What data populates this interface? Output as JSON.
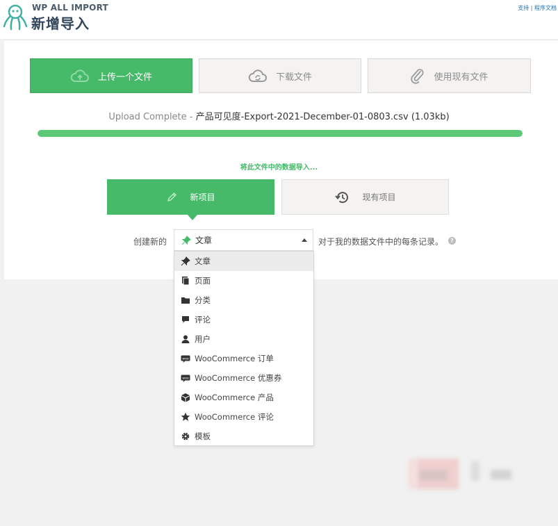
{
  "header": {
    "brand": "WP ALL IMPORT",
    "title": "新增导入",
    "links": [
      "支持",
      "程序文档"
    ],
    "separator": "|"
  },
  "tabs": [
    {
      "label": "上传一个文件",
      "icon": "cloud-upload-icon",
      "active": true
    },
    {
      "label": "下载文件",
      "icon": "cloud-download-icon",
      "active": false
    },
    {
      "label": "使用现有文件",
      "icon": "paperclip-icon",
      "active": false
    }
  ],
  "upload": {
    "status_prefix": "Upload Complete",
    "separator": " - ",
    "filename": "产品可见度-Export-2021-December-01-0803.csv",
    "size": "(1.03kb)",
    "progress": 1.0
  },
  "import_hint": "将此文件中的数据导入...",
  "choices": [
    {
      "label": "新项目",
      "icon": "pencil-icon",
      "active": true
    },
    {
      "label": "现有项目",
      "icon": "history-icon",
      "active": false
    }
  ],
  "create": {
    "prefix": "创建新的",
    "selected": "文章",
    "suffix": "对于我的数据文件中的每条记录。",
    "help": "?"
  },
  "dropdown": {
    "options": [
      {
        "label": "文章",
        "icon": "pushpin-icon"
      },
      {
        "label": "页面",
        "icon": "pages-icon"
      },
      {
        "label": "分类",
        "icon": "folder-icon"
      },
      {
        "label": "评论",
        "icon": "comment-icon"
      },
      {
        "label": "用户",
        "icon": "user-icon"
      },
      {
        "label": "WooCommerce 订单",
        "icon": "woo-icon"
      },
      {
        "label": "WooCommerce 优惠券",
        "icon": "woo-icon"
      },
      {
        "label": "WooCommerce 产品",
        "icon": "box-icon"
      },
      {
        "label": "WooCommerce 评论",
        "icon": "star-icon"
      },
      {
        "label": "模板",
        "icon": "gear-icon"
      }
    ],
    "highlighted_index": 0
  },
  "colors": {
    "accent_green": "#46ba69",
    "progress_green": "#5cc977",
    "title_navy": "#34465c"
  }
}
